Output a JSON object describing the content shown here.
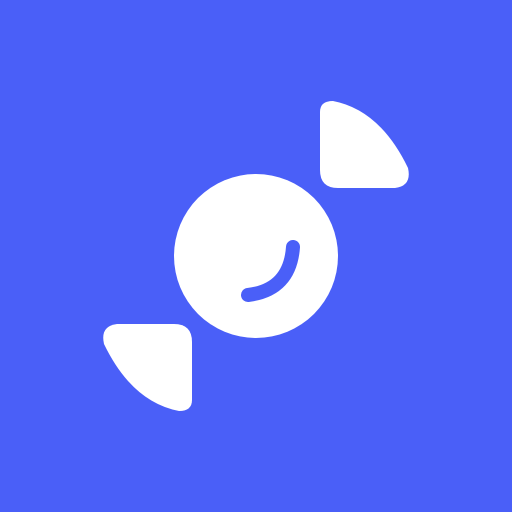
{
  "icon": {
    "name": "candy-icon",
    "background_color": "#4a5ff8",
    "foreground_color": "#ffffff"
  }
}
